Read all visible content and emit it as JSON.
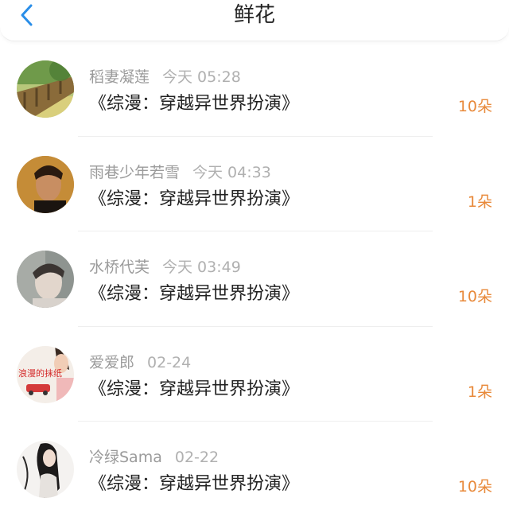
{
  "header": {
    "title": "鲜花",
    "back_icon": "chevron-left-icon",
    "accent": "#2a8ee8"
  },
  "colors": {
    "flower_count": "#e8893a",
    "meta": "#9b9b9b"
  },
  "items": [
    {
      "user": "稻妻凝莲",
      "time": "今天 05:28",
      "book": "《综漫：穿越异世界扮演》",
      "count": "10朵"
    },
    {
      "user": "雨巷少年若雪",
      "time": "今天 04:33",
      "book": "《综漫：穿越异世界扮演》",
      "count": "1朵"
    },
    {
      "user": "水桥代芙",
      "time": "今天 03:49",
      "book": "《综漫：穿越异世界扮演》",
      "count": "10朵"
    },
    {
      "user": "爱爱郎",
      "time": "02-24",
      "book": "《综漫：穿越异世界扮演》",
      "count": "1朵",
      "avatar_text": "浪漫的抹纸"
    },
    {
      "user": "冷绿Sama",
      "time": "02-22",
      "book": "《综漫：穿越异世界扮演》",
      "count": "10朵"
    }
  ]
}
